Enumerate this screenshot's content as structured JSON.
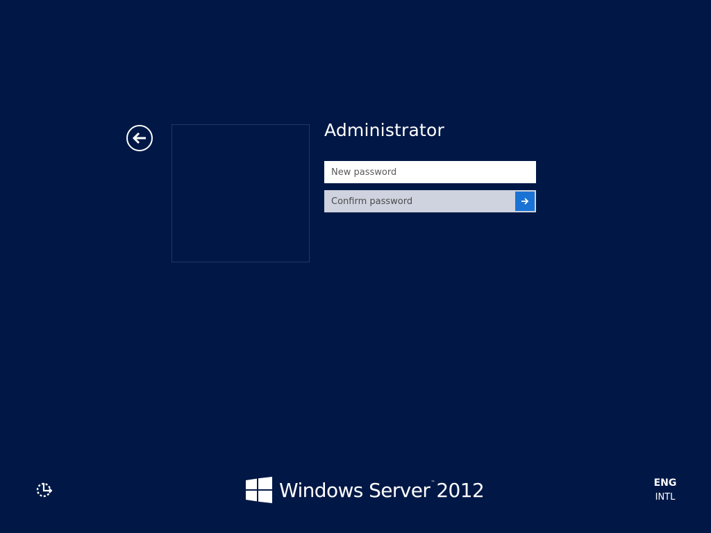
{
  "colors": {
    "background": "#011846",
    "tile_border": "#1e3868",
    "accent": "#1a73d4",
    "confirm_field_bg": "#cfd3df",
    "text": "#ffffff"
  },
  "nav": {
    "back_icon": "arrow-left-circle-icon"
  },
  "user": {
    "tile_icon": "user-tile",
    "name": "Administrator"
  },
  "form": {
    "new_password": {
      "value": "",
      "placeholder": "New password"
    },
    "confirm_password": {
      "value": "",
      "placeholder": "Confirm password"
    },
    "submit_icon": "arrow-right-icon"
  },
  "footer": {
    "ease_of_access_icon": "ease-of-access-icon",
    "brand": {
      "logo_icon": "windows-logo-icon",
      "name": "Windows Server",
      "trademark": "™",
      "version": "2012"
    },
    "language": {
      "code": "ENG",
      "layout": "INTL"
    }
  }
}
